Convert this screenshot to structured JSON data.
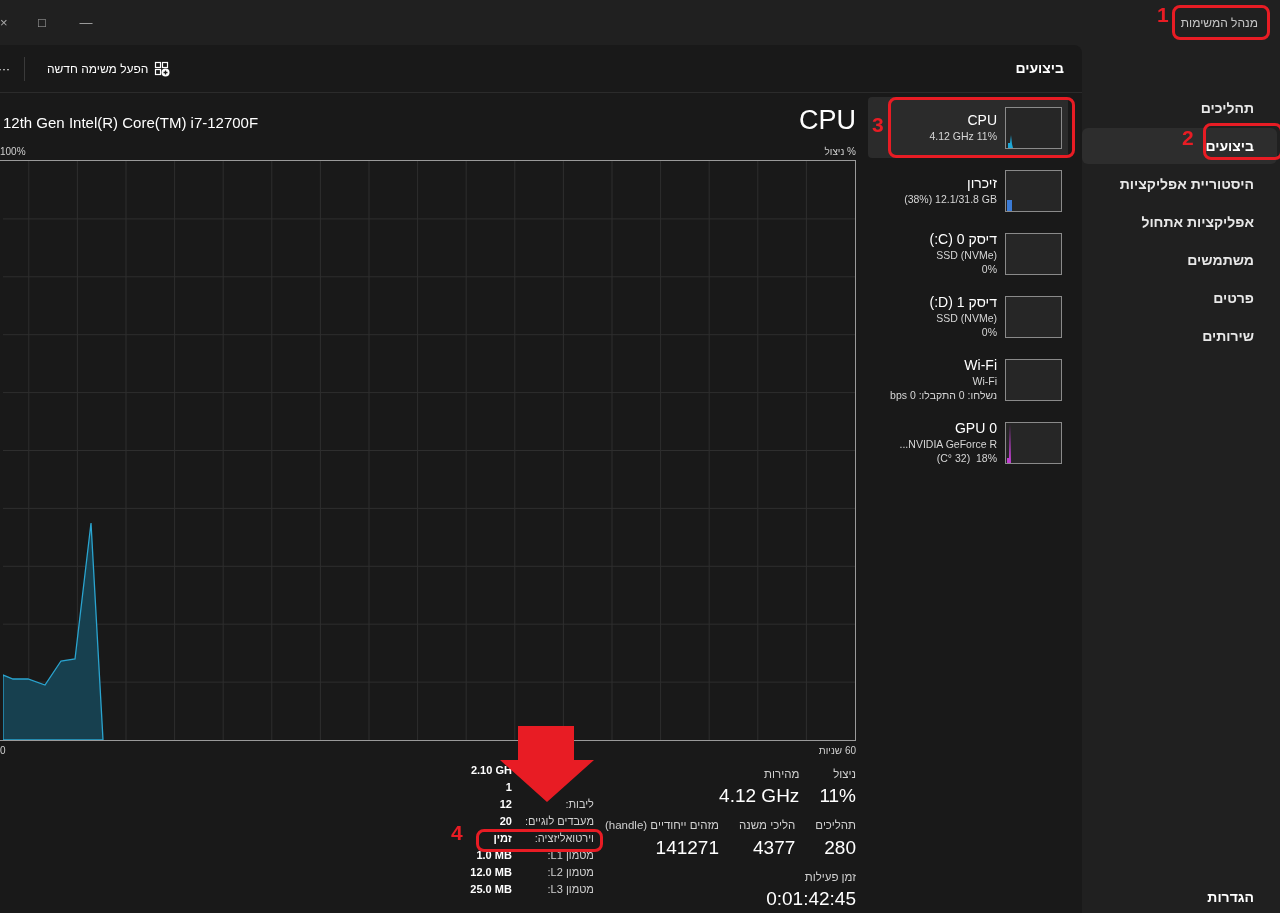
{
  "window": {
    "title": "מנהל המשימות",
    "controls": [
      "—",
      "□",
      "×"
    ]
  },
  "sidebar": {
    "items": [
      {
        "label": "תהליכים",
        "selected": false
      },
      {
        "label": "ביצועים",
        "selected": true
      },
      {
        "label": "היסטוריית אפליקציות",
        "selected": false
      },
      {
        "label": "אפליקציות אתחול",
        "selected": false
      },
      {
        "label": "משתמשים",
        "selected": false
      },
      {
        "label": "פרטים",
        "selected": false
      },
      {
        "label": "שירותים",
        "selected": false
      }
    ],
    "footer": "הגדרות"
  },
  "header": {
    "title": "ביצועים",
    "run_task_button": "הפעל משימה חדשה",
    "more": "···"
  },
  "devices": [
    {
      "title": "CPU",
      "lines": [
        "4.12 GHz 11%"
      ],
      "selected": true,
      "color": "#1ea7d6"
    },
    {
      "title": "זיכרון",
      "lines": [
        "(38%) 12.1/31.8 GB"
      ],
      "selected": false,
      "color": "#3b7bd6"
    },
    {
      "title": "דיסק 0 (C:)",
      "lines": [
        "SSD (NVMe)",
        "0%"
      ],
      "selected": false
    },
    {
      "title": "דיסק 1 (D:)",
      "lines": [
        "SSD (NVMe)",
        "0%"
      ],
      "selected": false
    },
    {
      "title": "Wi-Fi",
      "lines": [
        "Wi-Fi",
        "נשלחו: 0 התקבלו: bps 0"
      ],
      "selected": false
    },
    {
      "title": "GPU 0",
      "lines": [
        "NVIDIA GeForce R...",
        "(C° 32)  18%"
      ],
      "selected": false,
      "color": "#c040d0"
    }
  ],
  "cpu": {
    "title": "CPU",
    "model": "12th Gen Intel(R) Core(TM) i7-12700F",
    "y_label": "% ניצול",
    "y_max": "100%",
    "x_start": "0",
    "x_end": "60 שניות",
    "stats": [
      [
        {
          "label": "ניצול",
          "value": "11%"
        },
        {
          "label": "מהירות",
          "value": "4.12 GHz"
        }
      ],
      [
        {
          "label": "תהליכים",
          "value": "280"
        },
        {
          "label": "הליכי משנה",
          "value": "4377"
        },
        {
          "label": "מזהים ייחודיים (handle)",
          "value": "141271"
        }
      ],
      [
        {
          "label": "זמן פעילות",
          "value": "0:01:42:45"
        }
      ]
    ],
    "details": [
      {
        "value": "2.10 GH"
      },
      {
        "value": "1"
      },
      {
        "label": "ליבות:",
        "value": "12"
      },
      {
        "label": "מעבדים לוגיים:",
        "value": "20"
      },
      {
        "label": "וירטואליזציה:",
        "value": "זמין"
      },
      {
        "label": "מטמון L1:",
        "value": "1.0 MB"
      },
      {
        "label": "מטמון L2:",
        "value": "12.0 MB"
      },
      {
        "label": "מטמון L3:",
        "value": "25.0 MB"
      }
    ]
  },
  "annotations": [
    {
      "label": "1"
    },
    {
      "label": "2"
    },
    {
      "label": "3"
    },
    {
      "label": "4"
    }
  ]
}
